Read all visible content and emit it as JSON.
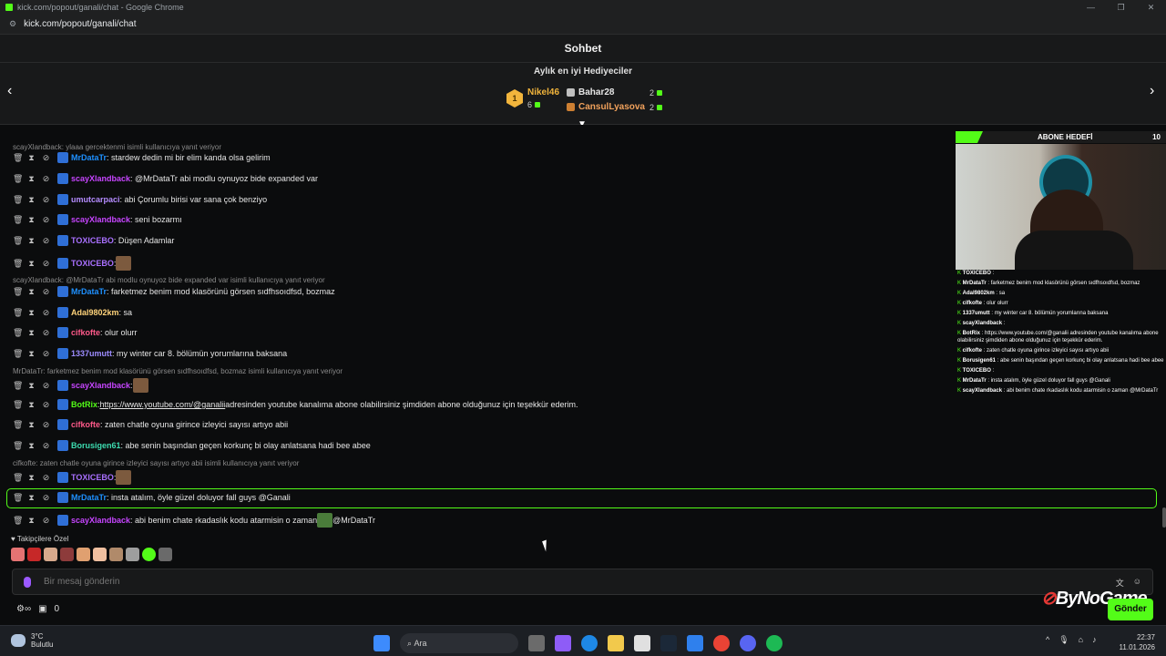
{
  "browser": {
    "window_title": "kick.com/popout/ganali/chat - Google Chrome",
    "url": "kick.com/popout/ganali/chat"
  },
  "header": {
    "title": "Sohbet"
  },
  "gifters": {
    "title": "Aylık en iyi Hediyeciler",
    "first": {
      "rank": "1",
      "name": "Nikel46",
      "count": "6"
    },
    "second": {
      "name": "Bahar28",
      "count": "2"
    },
    "third": {
      "name": "CansulLyasova",
      "count": "2"
    }
  },
  "chat": {
    "top_cut": "... ... ...",
    "reply1": "scayXlandback: ylaaa gercektenmi  isimli kullanıcıya yanıt veriyor",
    "messages": [
      {
        "user": "MrDataTr",
        "text": ": stardew dedin mi bir elim kanda olsa gelirim",
        "color": "#1e90ff"
      },
      {
        "user": "scayXlandback",
        "text": ": @MrDataTr abi modlu oynuyoz bide expanded var",
        "color": "#c745ff"
      },
      {
        "user": "umutcarpaci",
        "text": ": abi Çorumlu birisi var sana çok benziyo",
        "color": "#b58cff"
      },
      {
        "user": "scayXlandback",
        "text": ": seni bozarmı",
        "color": "#c745ff"
      },
      {
        "user": "TOXICEBO",
        "text": ": Düşen Adamlar",
        "color": "#a970ff"
      },
      {
        "user": "TOXICEBO",
        "text": ":",
        "color": "#a970ff"
      }
    ],
    "reply2": "scayXlandback: @MrDataTr abi modlu oynuyoz bide expanded var isimli kullanıcıya yanıt veriyor",
    "messages2": [
      {
        "user": "MrDataTr",
        "text": ": farketmez benim mod klasörünü görsen sıdfhsoıdfsd, bozmaz",
        "color": "#1e90ff"
      },
      {
        "user": "Adal9802km",
        "text": ": sa",
        "color": "#ffd37a"
      },
      {
        "user": "cifkofte",
        "text": ": olur olurr",
        "color": "#ff5a8a"
      },
      {
        "user": "1337umutt",
        "text": ": my winter car 8. bölümün yorumlarına baksana",
        "color": "#9d8cff"
      }
    ],
    "reply3": "MrDataTr: farketmez benim mod klasörünü görsen sıdfhsoıdfsd, bozmaz isimli kullanıcıya yanıt veriyor",
    "messages3": [
      {
        "user": "scayXlandback",
        "text": ":",
        "color": "#c745ff"
      },
      {
        "user": "BotRix",
        "text": ": ",
        "color": "#53fc18"
      },
      {
        "user": "cifkofte",
        "text": ": zaten chatle oyuna girince izleyici sayısı artıyo abii",
        "color": "#ff5a8a"
      },
      {
        "user": "Borusigen61",
        "text": ": abe senin başından geçen korkunç bi olay anlatsana hadi bee abee",
        "color": "#3ddcb0"
      }
    ],
    "botrix_link": "https://www.youtube.com/@ganalii",
    "botrix_rest": " adresinden youtube kanalıma abone olabilirsiniz şimdiden abone olduğunuz için teşekkür ederim.",
    "reply4": "cifkofte: zaten chatle oyuna girince izleyici sayısı artıyo abii isimli kullanıcıya yanıt veriyor",
    "messages4": [
      {
        "user": "TOXICEBO",
        "text": ":",
        "color": "#a970ff"
      },
      {
        "user": "MrDataTr",
        "text": ": insta atalım, öyle güzel doluyor fall guys @Ganali",
        "color": "#1e90ff"
      },
      {
        "user": "scayXlandback",
        "text": ": abi benim chate rkadaslık kodu atarmisin o zaman ",
        "color": "#c745ff"
      }
    ],
    "last_mention": "@MrDataTr"
  },
  "overlay": {
    "goal_label": "ABONE HEDEFİ",
    "goal_value": "10",
    "lines": [
      {
        "user": "TOXICEBO",
        "text": " : "
      },
      {
        "user": "MrDataTr",
        "text": " : farketmez benim mod klasörünü görsen sıdfhsoıdfsd, bozmaz"
      },
      {
        "user": "Adal9802km",
        "text": " : sa"
      },
      {
        "user": "cifkofte",
        "text": " : olur olurr"
      },
      {
        "user": "1337umutt",
        "text": " : my winter car 8. bölümün yorumlarına baksana"
      },
      {
        "user": "scayXlandback",
        "text": " : "
      },
      {
        "user": "BotRix",
        "text": " : https://www.youtube.com/@ganalii adresinden youtube kanalıma abone olabilirsiniz şimdiden abone olduğunuz için teşekkür ederim."
      },
      {
        "user": "cifkofte",
        "text": " : zaten chatle oyuna girince izleyici sayısı artıyo abii"
      },
      {
        "user": "Borusigen61",
        "text": " : abe senin başından geçen korkunç bi olay anlatsana hadi bee abee"
      },
      {
        "user": "TOXICEBO",
        "text": " : "
      },
      {
        "user": "MrDataTr",
        "text": " : insta atalım, öyle güzel doluyor fall guys @Ganali"
      },
      {
        "user": "scayXlandback",
        "text": " : abi benim chate rkadaslık kodu atarmisin o zaman @MrDataTr"
      }
    ]
  },
  "emotes": {
    "label": "Takipçilere Özel"
  },
  "input": {
    "placeholder": "Bir mesaj gönderin",
    "send_label": "Gönder"
  },
  "bottom": {
    "count": "0"
  },
  "watermark": "ByNoGame",
  "taskbar": {
    "temp": "3°C",
    "weather": "Bulutlu",
    "search": "Ara",
    "time": "22:37",
    "date": "11.01.2026"
  }
}
